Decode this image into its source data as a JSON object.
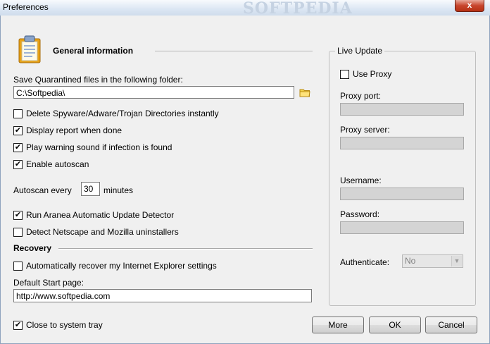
{
  "window": {
    "title": "Preferences",
    "close_label": "x"
  },
  "general": {
    "heading": "General information",
    "folder_label": "Save Quarantined files in the following folder:",
    "folder_value": "C:\\Softpedia\\",
    "options": [
      {
        "label": "Delete Spyware/Adware/Trojan Directories instantly",
        "checked": false
      },
      {
        "label": "Display report when done",
        "checked": true
      },
      {
        "label": "Play warning sound if infection is found",
        "checked": true
      },
      {
        "label": "Enable autoscan",
        "checked": true
      }
    ],
    "autoscan_prefix": "Autoscan every",
    "autoscan_value": "30",
    "autoscan_suffix": "minutes",
    "options2": [
      {
        "label": "Run Aranea Automatic Update Detector",
        "checked": true
      },
      {
        "label": "Detect Netscape and Mozilla uninstallers",
        "checked": false
      }
    ]
  },
  "recovery": {
    "heading": "Recovery",
    "ie_label": "Automatically recover my Internet Explorer settings",
    "ie_checked": false,
    "start_page_label": "Default Start page:",
    "start_page_value": "http://www.softpedia.com"
  },
  "tray": {
    "label": "Close to system tray",
    "checked": true
  },
  "live_update": {
    "title": "Live Update",
    "use_proxy_label": "Use Proxy",
    "use_proxy_checked": false,
    "proxy_port_label": "Proxy port:",
    "proxy_server_label": "Proxy server:",
    "username_label": "Username:",
    "password_label": "Password:",
    "authenticate_label": "Authenticate:",
    "authenticate_value": "No"
  },
  "buttons": {
    "more": "More",
    "ok": "OK",
    "cancel": "Cancel"
  },
  "watermark": "SOFTPEDIA"
}
